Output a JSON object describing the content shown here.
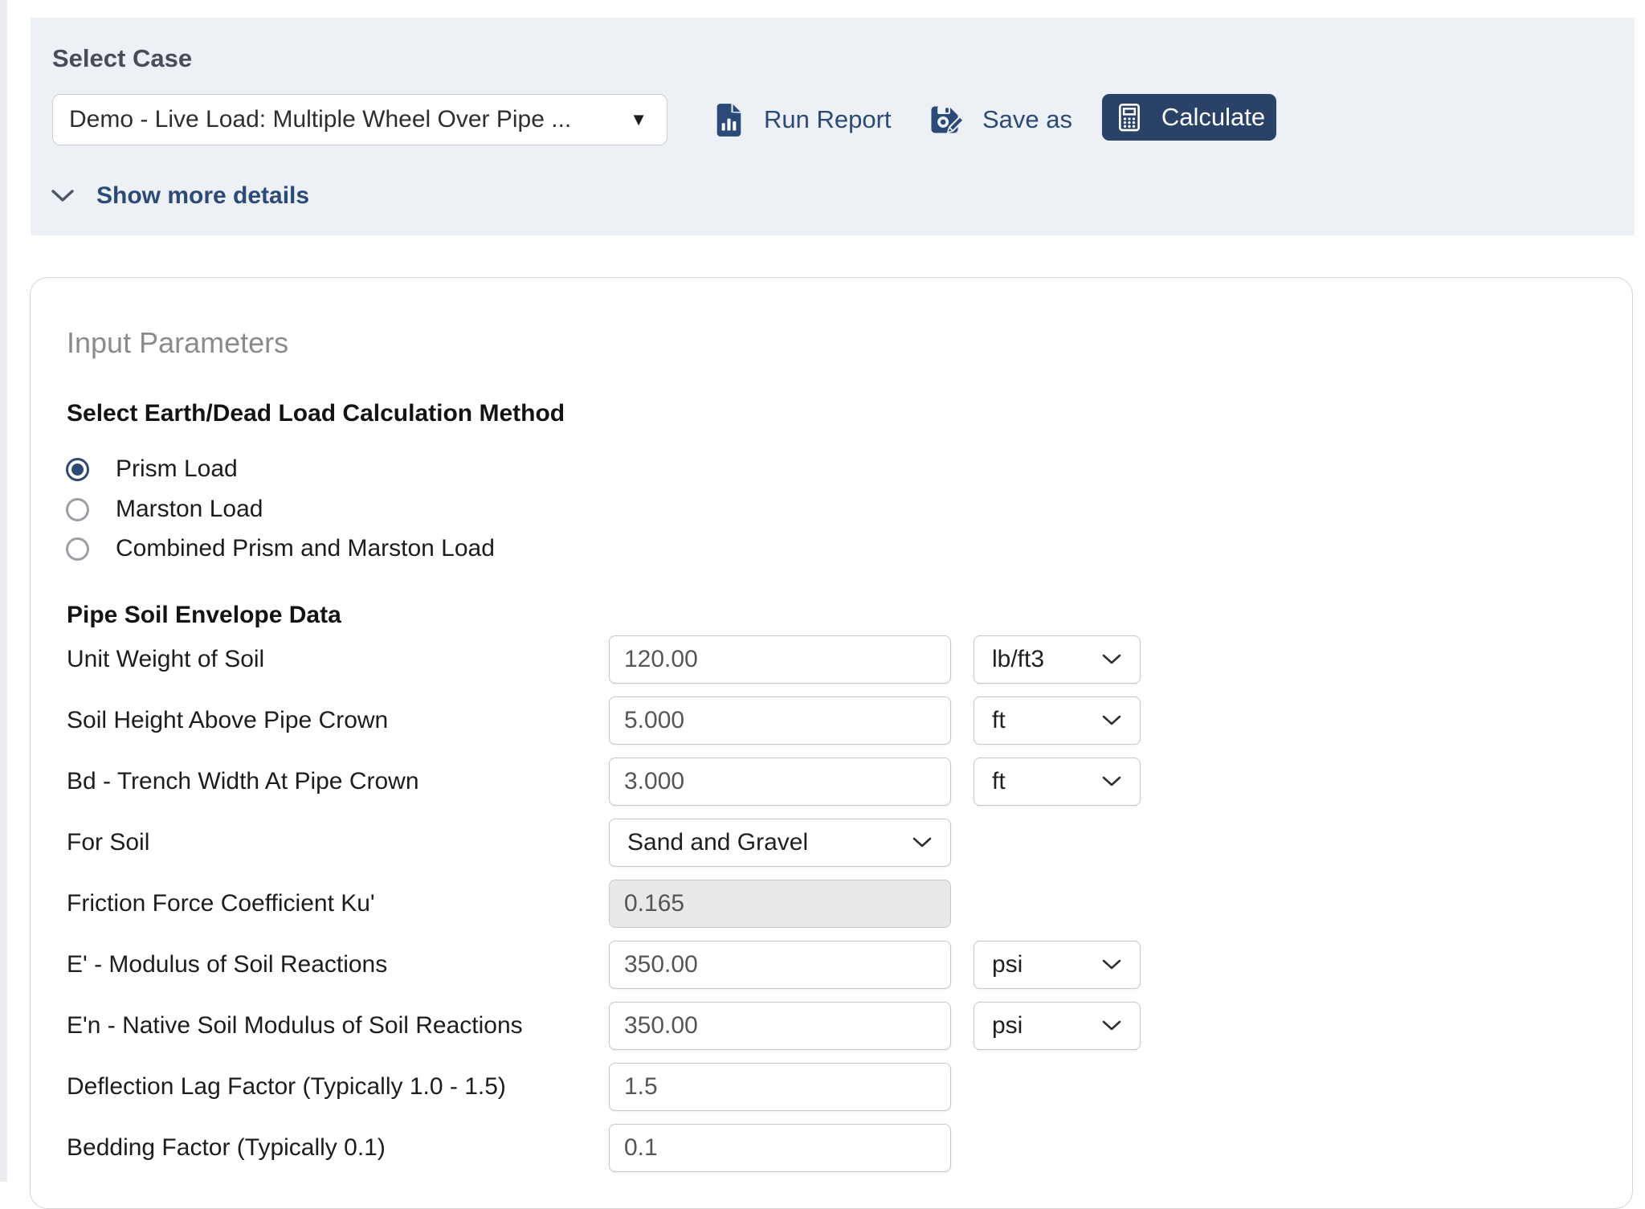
{
  "top_bar": {
    "heading": "Select Case",
    "case_dropdown": {
      "value": "Demo - Live Load: Multiple Wheel Over Pipe ..."
    },
    "run_report_label": "Run Report",
    "save_as_label": "Save as",
    "calculate_label": "Calculate",
    "show_more_label": "Show more details",
    "icons": {
      "run_report": "file-chart-icon",
      "save_as": "floppy-pencil-icon",
      "calculate": "calculator-icon",
      "show_more": "chevron-down-icon",
      "case_dropdown": "caret-down-icon"
    }
  },
  "colors": {
    "panel_bg": "#edf1f6",
    "navy_accent": "#2b4a77",
    "calculate_bg": "#2a4268",
    "disabled_field_bg": "#e9e9e9"
  },
  "card": {
    "title": "Input Parameters",
    "method": {
      "title": "Select Earth/Dead Load Calculation Method",
      "selected_value": "Prism Load",
      "options": [
        {
          "label": "Prism Load",
          "selected": true
        },
        {
          "label": "Marston Load",
          "selected": false
        },
        {
          "label": "Combined Prism and Marston Load",
          "selected": false
        }
      ]
    },
    "section": {
      "title": "Pipe Soil Envelope Data",
      "rows": [
        {
          "label": "Unit Weight of Soil",
          "value": "120.00",
          "unit": "lb/ft3"
        },
        {
          "label": "Soil Height Above Pipe Crown",
          "value": "5.000",
          "unit": "ft"
        },
        {
          "label": "Bd - Trench Width At Pipe Crown",
          "value": "3.000",
          "unit": "ft"
        },
        {
          "label": "For Soil",
          "value": "Sand and Gravel",
          "unit": ""
        },
        {
          "label": "Friction Force Coefficient Ku'",
          "value": "0.165",
          "unit": "",
          "disabled": true
        },
        {
          "label": "E' - Modulus of Soil Reactions",
          "value": "350.00",
          "unit": "psi"
        },
        {
          "label": "E'n - Native Soil Modulus of Soil Reactions",
          "value": "350.00",
          "unit": "psi"
        },
        {
          "label": "Deflection Lag Factor (Typically 1.0 - 1.5)",
          "value": "1.5",
          "unit": ""
        },
        {
          "label": "Bedding Factor (Typically 0.1)",
          "value": "0.1",
          "unit": ""
        }
      ]
    }
  }
}
